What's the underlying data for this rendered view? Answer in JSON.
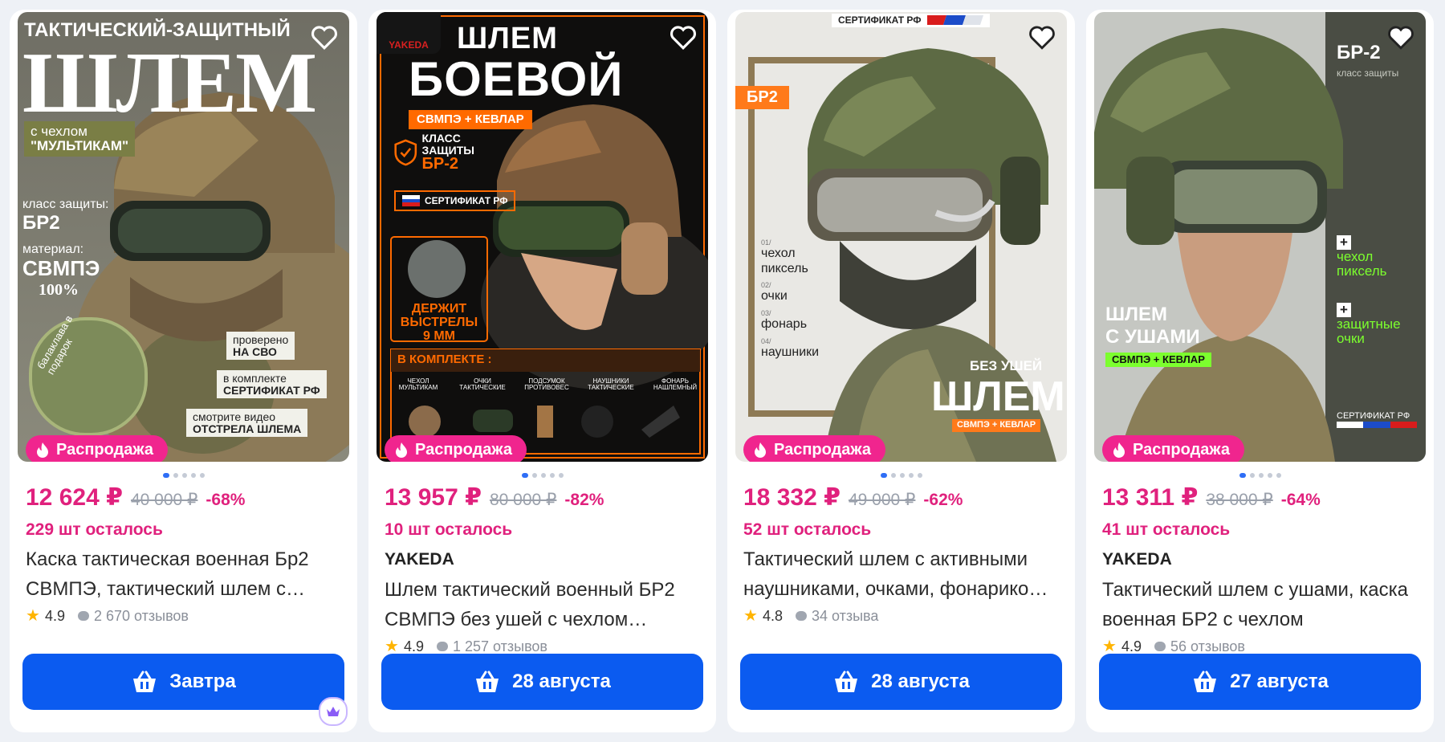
{
  "products": [
    {
      "sale_label": "Распродажа",
      "price": "12 624 ₽",
      "old_price": "40 000 ₽",
      "discount": "-68%",
      "stock": "229 шт осталось",
      "brand": "",
      "title": "Каска тактическая военная Бр2 СВМПЭ, тактический шлем с…",
      "rating": "4.9",
      "reviews": "2 670 отзывов",
      "delivery": "Завтра",
      "image_text": {
        "top": "ТАКТИЧЕСКИЙ-ЗАЩИТНЫЙ",
        "big": "ШЛЕМ",
        "tag1": "с чехлом",
        "tag2": "\"МУЛЬТИКАМ\"",
        "class_label": "класс защиты:",
        "class_value": "БР2",
        "material_label": "материал:",
        "material_value": "СВМПЭ",
        "material_pct": "100%",
        "gift": "балаклава в подарок",
        "f1a": "проверено",
        "f1b": "НА СВО",
        "f2a": "в комплекте",
        "f2b": "СЕРТИФИКАТ РФ",
        "f3a": "смотрите видео",
        "f3b": "ОТСТРЕЛА ШЛЕМА"
      }
    },
    {
      "sale_label": "Распродажа",
      "price": "13 957 ₽",
      "old_price": "80 000 ₽",
      "discount": "-82%",
      "stock": "10 шт осталось",
      "brand": "YAKEDA",
      "title": "Шлем тактический военный БР2 СВМПЭ без ушей с чехлом…",
      "rating": "4.9",
      "reviews": "1 257 отзывов",
      "delivery": "28 августа",
      "image_text": {
        "logo": "YAKEDA",
        "line1": "ШЛЕМ",
        "line2": "БОЕВОЙ",
        "tag": "СВМПЭ + КЕВЛАР",
        "class_a": "КЛАСС",
        "class_b": "ЗАЩИТЫ",
        "class_value": "БР-2",
        "cert": "СЕРТИФИКАТ РФ",
        "holds_a": "ДЕРЖИТ",
        "holds_b": "ВЫСТРЕЛЫ",
        "holds_c": "9 ММ",
        "kit_title": "В КОМПЛЕКТЕ :",
        "kit1": "ЧЕХОЛ МУЛЬТИКАМ",
        "kit2": "ОЧКИ ТАКТИЧЕСКИЕ",
        "kit3": "ПОДСУМОК ПРОТИВОВЕС",
        "kit4": "НАУШНИКИ ТАКТИЧЕСКИЕ",
        "kit5": "ФОНАРЬ НАШЛЕМНЫЙ"
      }
    },
    {
      "sale_label": "Распродажа",
      "price": "18 332 ₽",
      "old_price": "49 000 ₽",
      "discount": "-62%",
      "stock": "52 шт осталось",
      "brand": "",
      "title": "Тактический шлем с активными наушниками, очками, фонарико…",
      "rating": "4.8",
      "reviews": "34 отзыва",
      "delivery": "28 августа",
      "image_text": {
        "cert": "СЕРТИФИКАТ РФ",
        "tag": "БР2",
        "n1": "01/",
        "i1a": "чехол",
        "i1b": "пиксель",
        "n2": "02/",
        "i2": "очки",
        "n3": "03/",
        "i3": "фонарь",
        "n4": "04/",
        "i4": "наушники",
        "noears": "БЕЗ УШЕЙ",
        "big": "ШЛЕМ",
        "sub": "СВМПЭ + КЕВЛАР"
      }
    },
    {
      "sale_label": "Распродажа",
      "price": "13 311 ₽",
      "old_price": "38 000 ₽",
      "discount": "-64%",
      "stock": "41 шт осталось",
      "brand": "YAKEDA",
      "title": "Тактический шлем с ушами, каска военная БР2 с чехлом",
      "rating": "4.9",
      "reviews": "56 отзывов",
      "delivery": "27 августа",
      "image_text": {
        "class_value": "БР-2",
        "class_label": "класс защиты",
        "p1a": "чехол",
        "p1b": "пиксель",
        "p2a": "защитные",
        "p2b": "очки",
        "h1": "ШЛЕМ",
        "h2": "С УШАМИ",
        "tag": "СВМПЭ + КЕВЛАР",
        "cert": "СЕРТИФИКАТ РФ"
      }
    }
  ],
  "colors": {
    "accent": "#e0217d",
    "button": "#0b5bf0",
    "sale_badge": "#f0258e",
    "neon": "#7cff2e",
    "orange": "#ff7a1a"
  },
  "icons": [
    "heart-icon",
    "flame-icon",
    "basket-icon",
    "star-icon",
    "comment-icon",
    "crown-icon"
  ]
}
